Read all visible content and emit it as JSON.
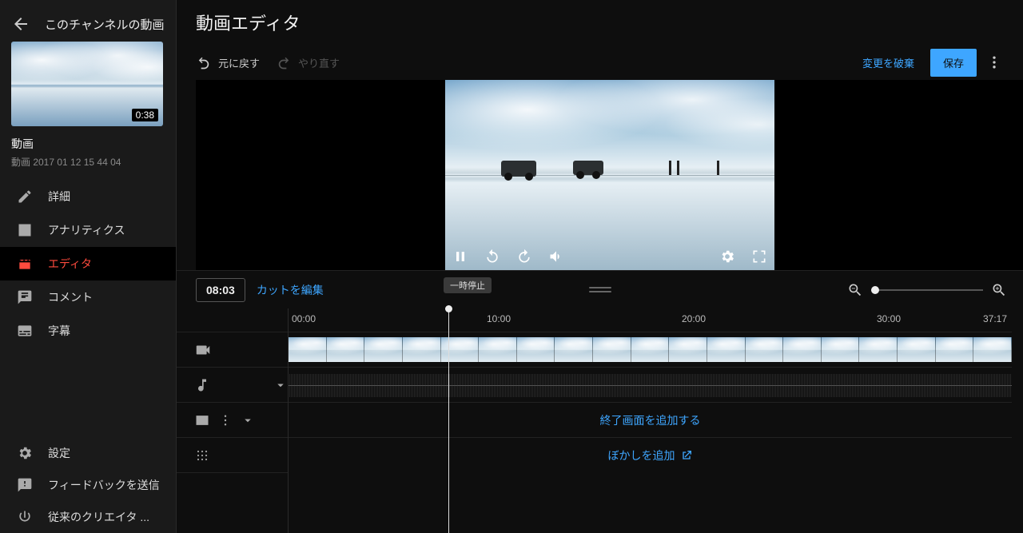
{
  "sidebar": {
    "back_title": "このチャンネルの動画",
    "thumb_duration": "0:38",
    "video_title": "動画",
    "video_subtitle": "動画 2017 01 12 15 44 04",
    "nav": [
      {
        "id": "details",
        "label": "詳細"
      },
      {
        "id": "analytics",
        "label": "アナリティクス"
      },
      {
        "id": "editor",
        "label": "エディタ"
      },
      {
        "id": "comments",
        "label": "コメント"
      },
      {
        "id": "subtitles",
        "label": "字幕"
      }
    ],
    "footer": [
      {
        "id": "settings",
        "label": "設定"
      },
      {
        "id": "feedback",
        "label": "フィードバックを送信"
      },
      {
        "id": "classic",
        "label": "従来のクリエイタ ..."
      }
    ]
  },
  "header": {
    "page_title": "動画エディタ"
  },
  "toolbar": {
    "undo": "元に戻す",
    "redo": "やり直す",
    "discard": "変更を破棄",
    "save": "保存"
  },
  "preview": {
    "tooltip_pause": "一時停止"
  },
  "timebar": {
    "timecode": "08:03",
    "edit_cut": "カットを編集"
  },
  "timeline": {
    "ticks": [
      "00:00",
      "10:00",
      "20:00",
      "30:00"
    ],
    "end": "37:17",
    "end_screen_label": "終了画面を追加する",
    "blur_label": "ぼかしを追加"
  }
}
